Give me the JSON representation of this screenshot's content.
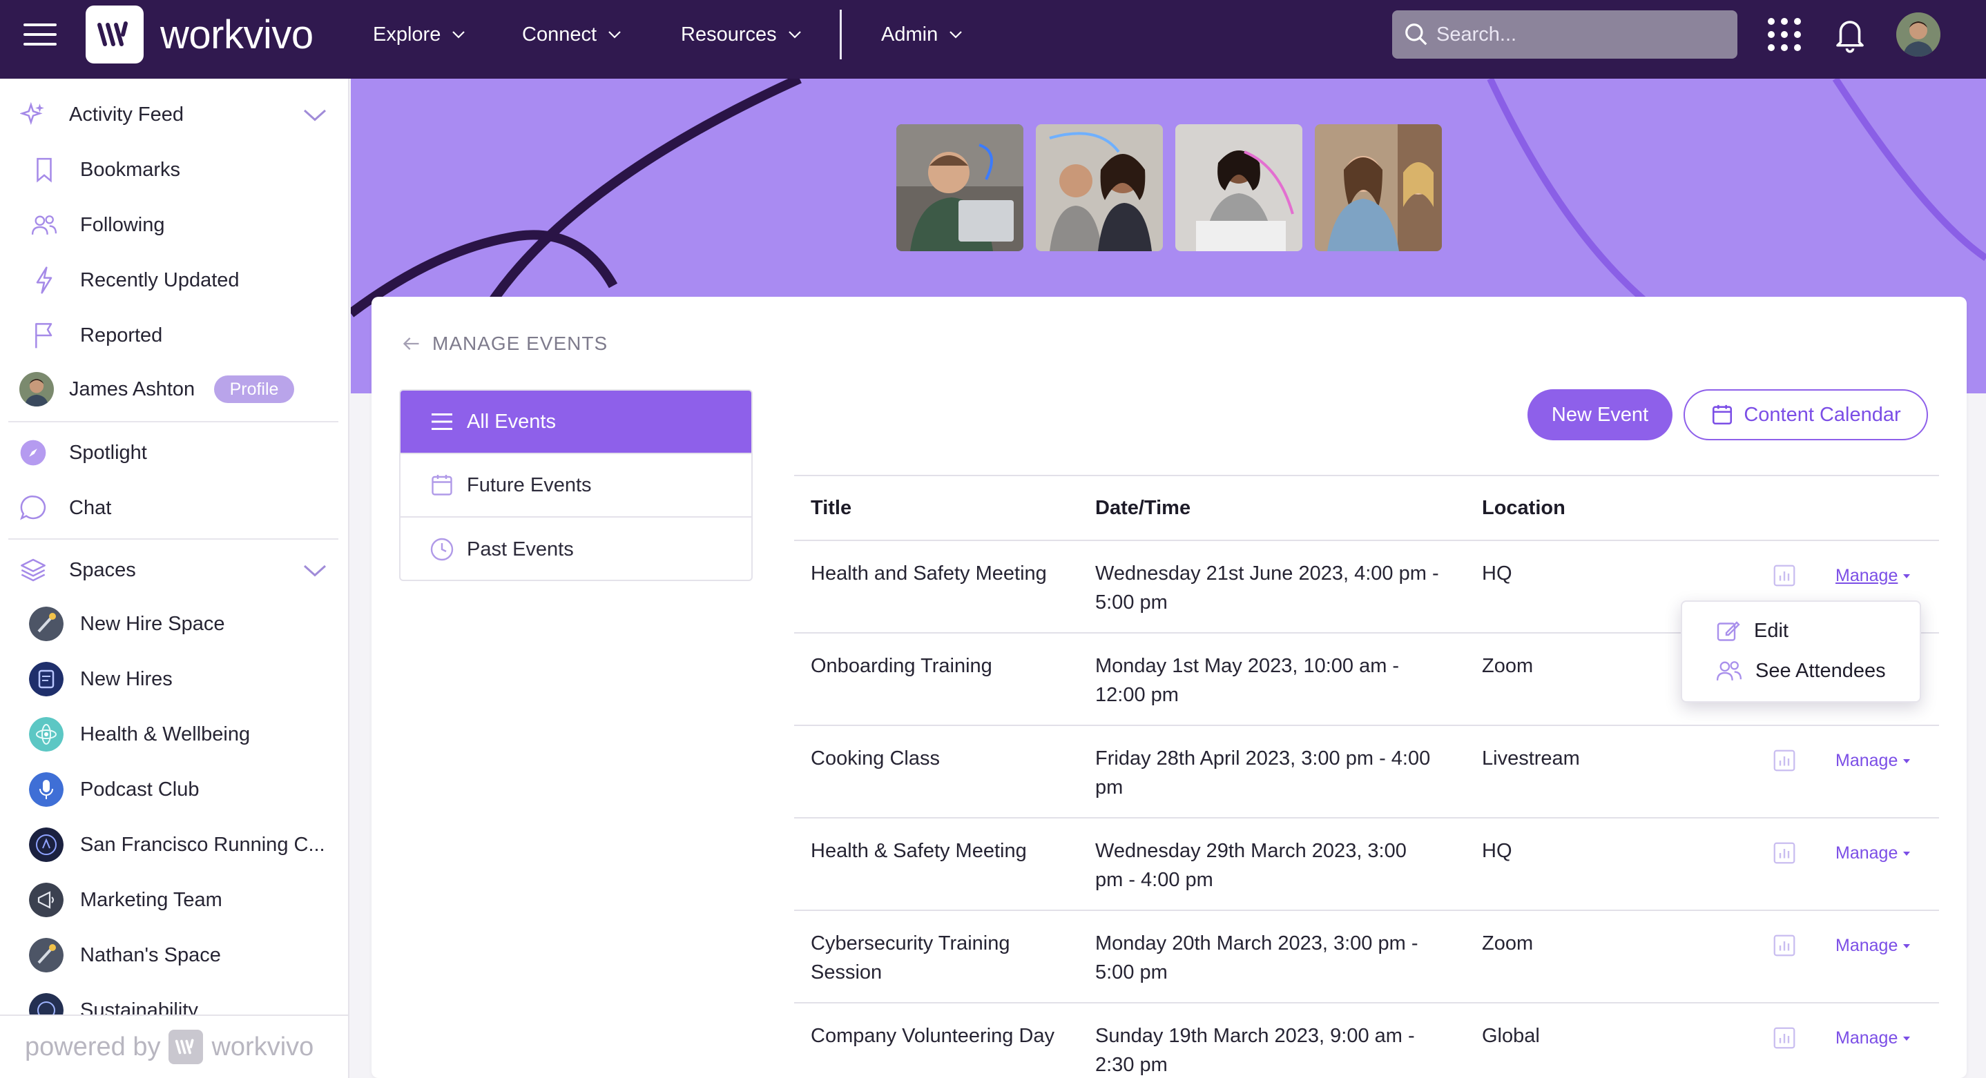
{
  "topbar": {
    "brand": "workvivo",
    "nav": [
      "Explore",
      "Connect",
      "Resources",
      "Admin"
    ],
    "search_placeholder": "Search..."
  },
  "sidebar": {
    "activity_feed": "Activity Feed",
    "feed_items": [
      "Bookmarks",
      "Following",
      "Recently Updated",
      "Reported"
    ],
    "user_name": "James Ashton",
    "profile_badge": "Profile",
    "spotlight": "Spotlight",
    "chat": "Chat",
    "spaces": "Spaces",
    "space_items": [
      "New Hire Space",
      "New Hires",
      "Health & Wellbeing",
      "Podcast Club",
      "San Francisco Running C...",
      "Marketing Team",
      "Nathan's Space",
      "Sustainability"
    ],
    "powered_by": "powered by",
    "powered_brand": "workvivo"
  },
  "main": {
    "back_label": "MANAGE EVENTS",
    "filters": [
      "All Events",
      "Future Events",
      "Past Events"
    ],
    "new_event": "New Event",
    "content_calendar": "Content Calendar",
    "columns": [
      "Title",
      "Date/Time",
      "Location"
    ],
    "manage_label": "Manage",
    "rows": [
      {
        "title": [
          "Health and Safety Meeting"
        ],
        "datetime": [
          "Wednesday 21st June 2023, 4:00 pm -",
          "5:00 pm"
        ],
        "location": "HQ"
      },
      {
        "title": [
          "Onboarding Training"
        ],
        "datetime": [
          "Monday 1st May 2023, 10:00 am -",
          "12:00 pm"
        ],
        "location": "Zoom"
      },
      {
        "title": [
          "Cooking Class"
        ],
        "datetime": [
          "Friday 28th April 2023, 3:00 pm - 4:00",
          "pm"
        ],
        "location": "Livestream"
      },
      {
        "title": [
          "Health & Safety Meeting"
        ],
        "datetime": [
          "Wednesday 29th March 2023, 3:00",
          "pm - 4:00 pm"
        ],
        "location": "HQ"
      },
      {
        "title": [
          "Cybersecurity Training",
          "Session"
        ],
        "datetime": [
          "Monday 20th March 2023, 3:00 pm -",
          "5:00 pm"
        ],
        "location": "Zoom"
      },
      {
        "title": [
          "Company Volunteering Day"
        ],
        "datetime": [
          "Sunday 19th March 2023, 9:00 am -",
          "2:30 pm"
        ],
        "location": "Global"
      }
    ],
    "dropdown": {
      "edit": "Edit",
      "see_attendees": "See Attendees"
    }
  },
  "colors": {
    "topbar": "#30194f",
    "accent": "#8e60ea",
    "hero": "#a98bf2"
  }
}
